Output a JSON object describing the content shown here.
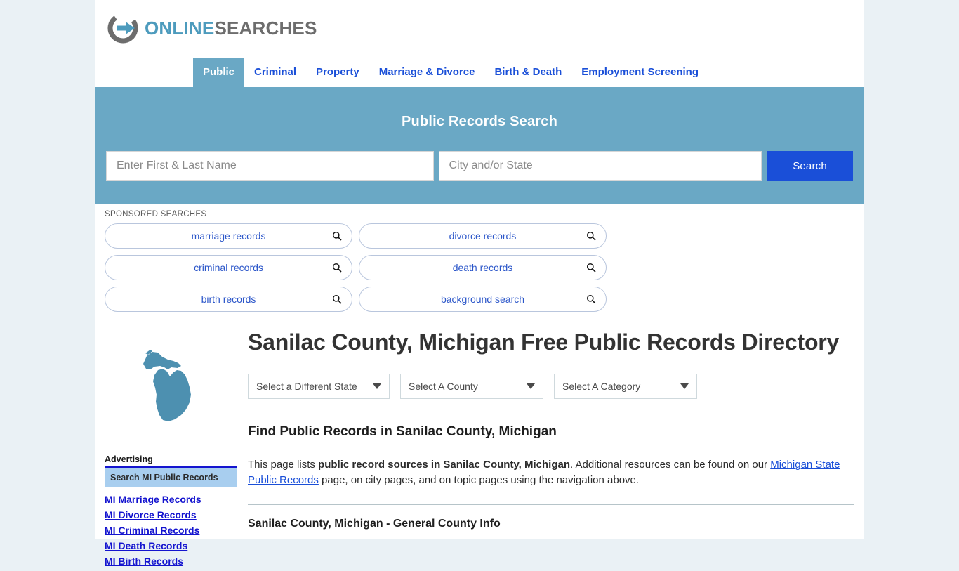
{
  "site": {
    "logo_online": "ONLINE",
    "logo_searches": "SEARCHES",
    "logo_icon": "circle-arrow-icon"
  },
  "nav": {
    "items": [
      {
        "label": "Public",
        "active": true
      },
      {
        "label": "Criminal",
        "active": false
      },
      {
        "label": "Property",
        "active": false
      },
      {
        "label": "Marriage & Divorce",
        "active": false
      },
      {
        "label": "Birth & Death",
        "active": false
      },
      {
        "label": "Employment Screening",
        "active": false
      }
    ]
  },
  "banner": {
    "title": "Public Records Search",
    "name_placeholder": "Enter First & Last Name",
    "name_value": "",
    "city_placeholder": "City and/or State",
    "city_value": "",
    "search_label": "Search",
    "bg_color": "#6aa8c5",
    "button_color": "#1a4fd8"
  },
  "sponsored": {
    "label": "SPONSORED SEARCHES",
    "pills": [
      "marriage records",
      "divorce records",
      "criminal records",
      "death records",
      "birth records",
      "background search"
    ],
    "icon": "magnifier-icon"
  },
  "sidebar": {
    "map_icon": "michigan-state-map",
    "ad_label": "Advertising",
    "ad_box_title": "Search MI Public Records",
    "links": [
      "MI Marriage Records",
      "MI Divorce Records",
      "MI Criminal Records",
      "MI Death Records",
      "MI Birth Records"
    ]
  },
  "main": {
    "page_title": "Sanilac County, Michigan Free Public Records Directory",
    "selects": [
      {
        "label": "Select a Different State"
      },
      {
        "label": "Select A County"
      },
      {
        "label": "Select A Category"
      }
    ],
    "sub_head": "Find Public Records in Sanilac County, Michigan",
    "paragraph": {
      "p1": "This page lists ",
      "bold1": "public record sources in Sanilac County, Michigan",
      "p2": ". Additional resources can be found on our ",
      "link1": "Michigan State Public Records",
      "p3": " page, on city pages, and on topic pages using the navigation above."
    },
    "section_head": "Sanilac County, Michigan - General County Info"
  }
}
